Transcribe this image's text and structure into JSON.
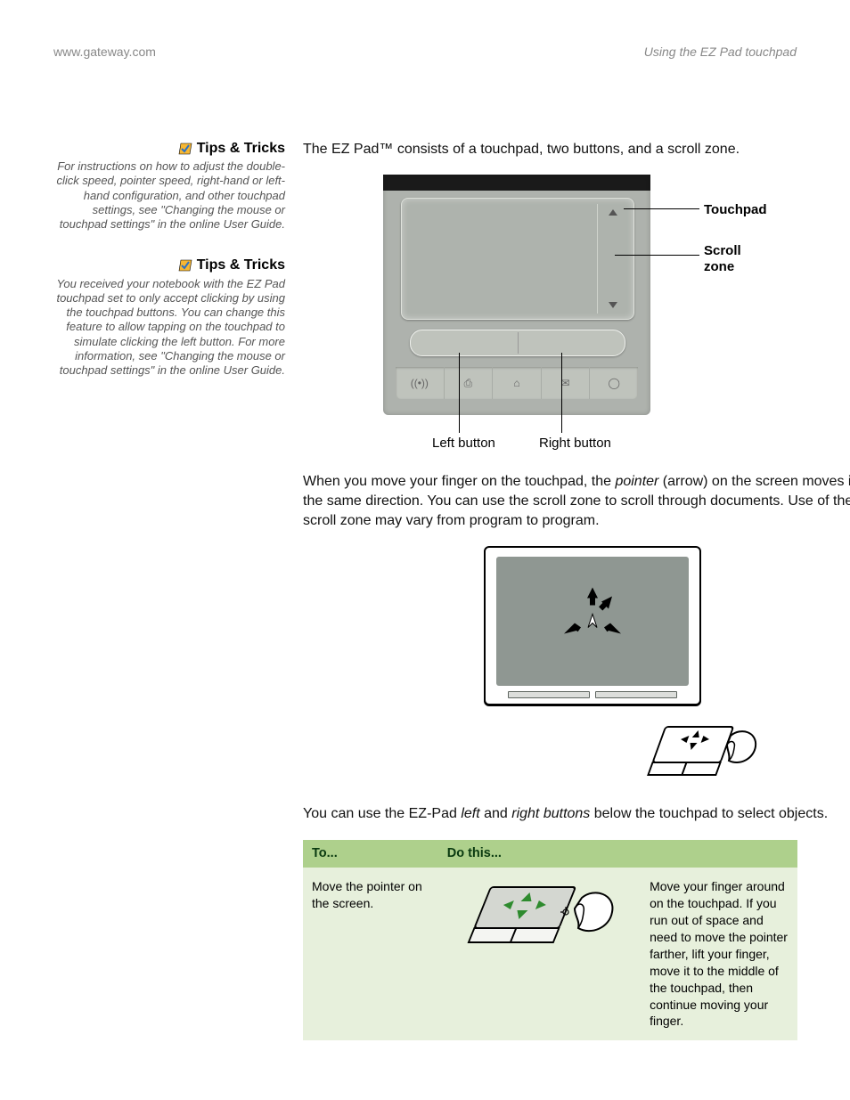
{
  "header": {
    "left": "www.gateway.com",
    "right": "Using the EZ Pad touchpad"
  },
  "sidebar": {
    "tips": [
      {
        "title": "Tips & Tricks",
        "body": "For instructions on how to adjust the double-click speed, pointer speed, right-hand or left-hand configuration, and other touchpad settings, see \"Changing the mouse or touchpad settings\" in the online User Guide."
      },
      {
        "title": "Tips & Tricks",
        "body": "You received your notebook with the EZ Pad touchpad set to only accept clicking by using the touchpad buttons. You can change this feature to allow tapping on the touchpad to simulate clicking the left button. For more information, see \"Changing the mouse or touchpad settings\" in the online User Guide."
      }
    ]
  },
  "main": {
    "intro": "The EZ Pad™ consists of a touchpad, two buttons, and a scroll zone.",
    "diagram_labels": {
      "touchpad": "Touchpad",
      "scroll_zone_l1": "Scroll",
      "scroll_zone_l2": "zone",
      "left_button": "Left button",
      "right_button": "Right button"
    },
    "para2_pre": "When you move your finger on the touchpad, the ",
    "para2_em": "pointer",
    "para2_post": " (arrow) on the screen moves in the same direction. You can use the scroll zone to scroll through documents. Use of the scroll zone may vary from program to program.",
    "para3_pre": "You can use the EZ-Pad ",
    "para3_em1": "left",
    "para3_mid": " and ",
    "para3_em2": "right buttons",
    "para3_post": " below the touchpad to select objects."
  },
  "table": {
    "head": {
      "to": "To...",
      "do": "Do this..."
    },
    "rows": [
      {
        "to": "Move the pointer on the screen.",
        "desc": "Move your finger around on the touchpad. If you run out of space and need to move the pointer farther, lift your finger, move it to the middle of the touchpad, then continue moving your finger."
      }
    ]
  }
}
